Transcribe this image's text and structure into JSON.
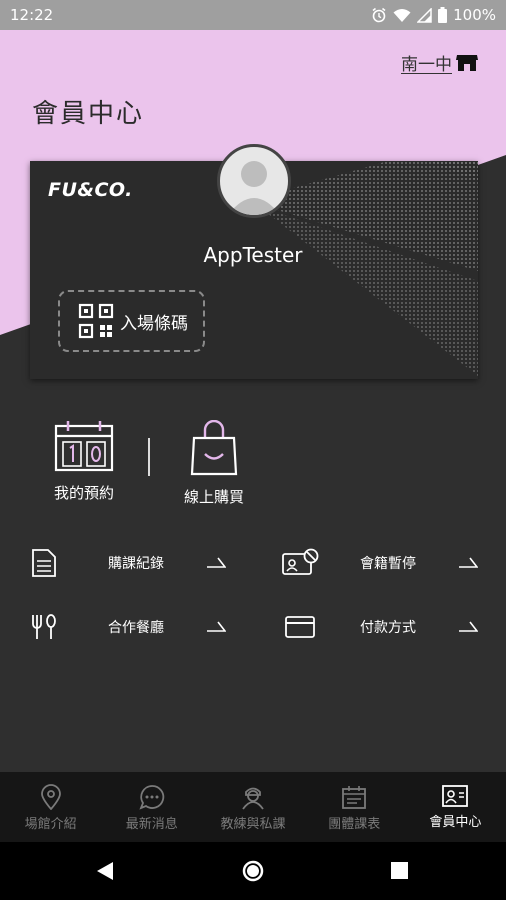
{
  "status": {
    "time": "12:22",
    "battery": "100%"
  },
  "header": {
    "branch": "南一中",
    "title": "會員中心"
  },
  "card": {
    "brand": "FU&CO.",
    "username": "AppTester",
    "checkin_label": "入場條碼"
  },
  "quick_actions": [
    {
      "label": "我的預約",
      "icon": "calendar-icon"
    },
    {
      "label": "線上購買",
      "icon": "shopping-bag-icon"
    }
  ],
  "menu": [
    {
      "label": "購課紀錄",
      "icon": "document-icon"
    },
    {
      "label": "會籍暫停",
      "icon": "id-card-pause-icon"
    },
    {
      "label": "合作餐廳",
      "icon": "utensils-icon"
    },
    {
      "label": "付款方式",
      "icon": "credit-card-icon"
    }
  ],
  "bottom_nav": [
    {
      "label": "場館介紹",
      "icon": "location-pin-icon",
      "active": false
    },
    {
      "label": "最新消息",
      "icon": "chat-bubble-icon",
      "active": false
    },
    {
      "label": "教練與私課",
      "icon": "coach-icon",
      "active": false
    },
    {
      "label": "團體課表",
      "icon": "calendar-icon",
      "active": false
    },
    {
      "label": "會員中心",
      "icon": "member-card-icon",
      "active": true
    }
  ],
  "colors": {
    "header_pink": "#ebc4ec",
    "dark_bg": "#2f2f2f",
    "accent_purple": "#e3b7ea"
  }
}
